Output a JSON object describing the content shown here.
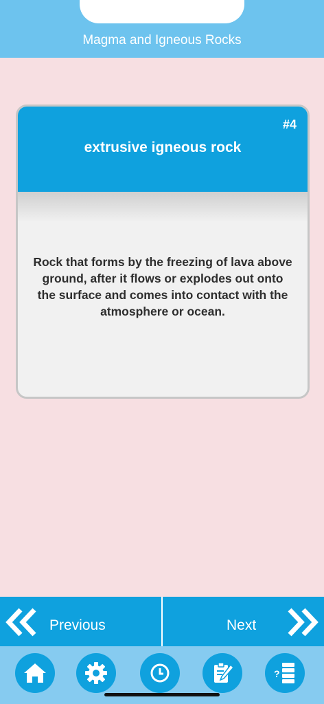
{
  "header": {
    "title": "Magma and Igneous Rocks"
  },
  "card": {
    "number": "#4",
    "term": "extrusive igneous rock",
    "definition": "Rock that forms by the freezing of lava above ground, after it flows or explodes out onto the surface and comes into contact with the atmosphere or ocean."
  },
  "navigation": {
    "previous_label": "Previous",
    "next_label": "Next"
  },
  "tabs": [
    {
      "icon": "home-icon"
    },
    {
      "icon": "gear-icon"
    },
    {
      "icon": "clock-icon"
    },
    {
      "icon": "edit-note-icon"
    },
    {
      "icon": "quiz-list-icon"
    }
  ],
  "colors": {
    "header": "#6dc3ee",
    "primary": "#0fa1de",
    "background": "#f7dfe2",
    "tabbar": "#86cbf0"
  }
}
